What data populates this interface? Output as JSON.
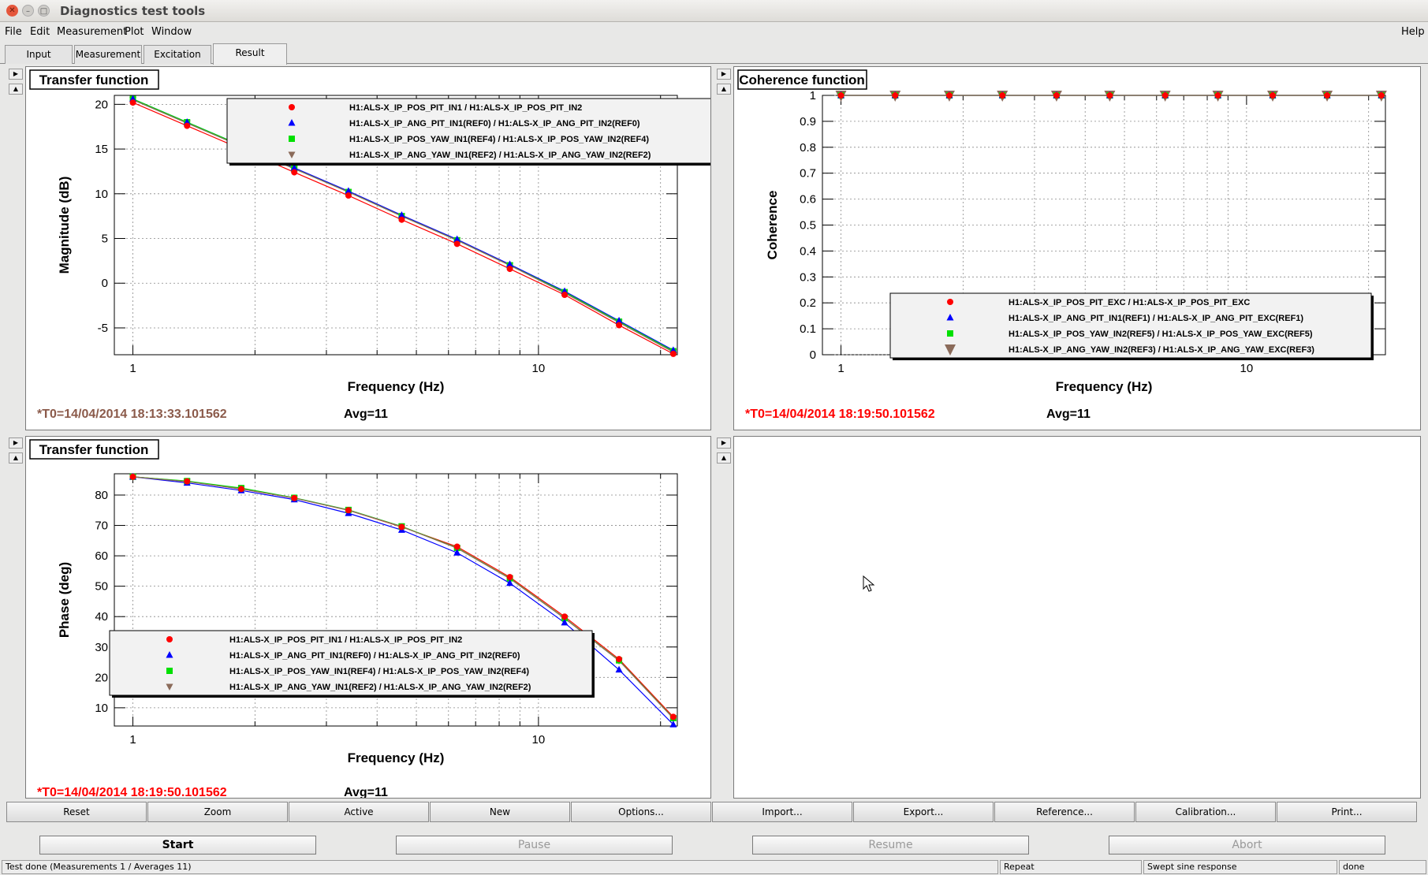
{
  "window": {
    "title": "Diagnostics test tools"
  },
  "menu": {
    "file": "File",
    "edit": "Edit",
    "measurement": "Measurement",
    "plot": "Plot",
    "window": "Window",
    "help": "Help"
  },
  "tabs": [
    {
      "label": "Input"
    },
    {
      "label": "Measurement"
    },
    {
      "label": "Excitation"
    },
    {
      "label": "Result",
      "active": true
    }
  ],
  "icons": {
    "close": "close-icon",
    "minimize": "minimize-icon",
    "maximize": "maximize-icon",
    "pad_next": "arrow-right-icon",
    "pad_prev": "arrow-up-icon",
    "cursor": "mouse-pointer-icon"
  },
  "colors": {
    "series": [
      "#ff0000",
      "#0000ff",
      "#00e000",
      "#8b6b5a"
    ],
    "timestamp_brown": "#8b5a4a",
    "timestamp_red": "#ff0000"
  },
  "pads": {
    "tl": {
      "title": "Transfer function",
      "t0": "*T0=14/04/2014 18:13:33.101562",
      "avg": "Avg=11"
    },
    "tr": {
      "title": "Coherence function",
      "t0": "*T0=14/04/2014 18:19:50.101562",
      "avg": "Avg=11"
    },
    "bl": {
      "title": "Transfer function",
      "t0": "*T0=14/04/2014 18:19:50.101562",
      "avg": "Avg=11"
    }
  },
  "chart_data": [
    {
      "type": "line",
      "title": "Transfer function",
      "xlabel": "Frequency (Hz)",
      "ylabel": "Magnitude (dB)",
      "xscale": "log",
      "xlim": [
        0.9,
        22
      ],
      "ylim": [
        -8,
        21
      ],
      "yticks": [
        -5,
        0,
        5,
        10,
        15,
        20
      ],
      "xticks": [
        1,
        10
      ],
      "legend_position": "top-right",
      "x": [
        1,
        1.36,
        1.85,
        2.5,
        3.4,
        4.6,
        6.3,
        8.5,
        11.6,
        15.8,
        21.5
      ],
      "series": [
        {
          "name": "H1:ALS-X_IP_POS_PIT_IN1 / H1:ALS-X_IP_POS_PIT_IN2",
          "marker": "circle",
          "values": [
            20.2,
            17.6,
            15.0,
            12.4,
            9.8,
            7.1,
            4.4,
            1.6,
            -1.3,
            -4.7,
            -7.9
          ]
        },
        {
          "name": "H1:ALS-X_IP_ANG_PIT_IN1(REF0) / H1:ALS-X_IP_ANG_PIT_IN2(REF0)",
          "marker": "triangle",
          "values": [
            20.6,
            18.0,
            15.4,
            12.9,
            10.3,
            7.6,
            4.9,
            2.1,
            -0.9,
            -4.2,
            -7.5
          ]
        },
        {
          "name": "H1:ALS-X_IP_POS_YAW_IN1(REF4) / H1:ALS-X_IP_POS_YAW_IN2(REF4)",
          "marker": "square",
          "values": [
            20.6,
            18.0,
            15.4,
            12.8,
            10.2,
            7.5,
            4.8,
            2.0,
            -1.0,
            -4.3,
            -7.6
          ]
        },
        {
          "name": "H1:ALS-X_IP_ANG_YAW_IN1(REF2) / H1:ALS-X_IP_ANG_YAW_IN2(REF2)",
          "marker": "triangle-down",
          "values": [
            20.5,
            17.9,
            15.3,
            12.8,
            10.2,
            7.5,
            4.8,
            2.0,
            -1.1,
            -4.4,
            -7.7
          ]
        }
      ]
    },
    {
      "type": "line",
      "title": "Coherence function",
      "xlabel": "Frequency (Hz)",
      "ylabel": "Coherence",
      "xscale": "log",
      "xlim": [
        0.9,
        22
      ],
      "ylim": [
        0,
        1
      ],
      "yticks": [
        0,
        0.1,
        0.2,
        0.3,
        0.4,
        0.5,
        0.6,
        0.7,
        0.8,
        0.9,
        1
      ],
      "xticks": [
        1,
        10
      ],
      "legend_position": "bottom-right",
      "x": [
        1,
        1.36,
        1.85,
        2.5,
        3.4,
        4.6,
        6.3,
        8.5,
        11.6,
        15.8,
        21.5
      ],
      "series": [
        {
          "name": "H1:ALS-X_IP_POS_PIT_EXC / H1:ALS-X_IP_POS_PIT_EXC",
          "marker": "circle",
          "values": [
            1,
            1,
            1,
            1,
            1,
            1,
            1,
            1,
            1,
            1,
            1
          ]
        },
        {
          "name": "H1:ALS-X_IP_ANG_PIT_IN1(REF1) / H1:ALS-X_IP_ANG_PIT_EXC(REF1)",
          "marker": "triangle",
          "values": [
            1,
            1,
            1,
            1,
            1,
            1,
            1,
            1,
            1,
            1,
            1
          ]
        },
        {
          "name": "H1:ALS-X_IP_POS_YAW_IN2(REF5) / H1:ALS-X_IP_POS_YAW_EXC(REF5)",
          "marker": "square",
          "values": [
            1,
            1,
            1,
            1,
            1,
            1,
            1,
            1,
            1,
            1,
            1
          ]
        },
        {
          "name": "H1:ALS-X_IP_ANG_YAW_IN2(REF3) / H1:ALS-X_IP_ANG_YAW_EXC(REF3)",
          "marker": "triangle-down-large",
          "values": [
            1,
            1,
            1,
            1,
            1,
            1,
            1,
            1,
            1,
            1,
            1
          ]
        }
      ]
    },
    {
      "type": "line",
      "title": "Transfer function",
      "xlabel": "Frequency (Hz)",
      "ylabel": "Phase (deg)",
      "xscale": "log",
      "xlim": [
        0.9,
        22
      ],
      "ylim": [
        4,
        87
      ],
      "yticks": [
        10,
        20,
        30,
        40,
        50,
        60,
        70,
        80
      ],
      "xticks": [
        1,
        10
      ],
      "legend_position": "bottom-left",
      "x": [
        1,
        1.36,
        1.85,
        2.5,
        3.4,
        4.6,
        6.3,
        8.5,
        11.6,
        15.8,
        21.5
      ],
      "series": [
        {
          "name": "H1:ALS-X_IP_POS_PIT_IN1 / H1:ALS-X_IP_POS_PIT_IN2",
          "marker": "circle",
          "values": [
            86,
            84.5,
            82,
            79,
            75,
            69.5,
            63,
            53,
            40,
            26,
            7
          ]
        },
        {
          "name": "H1:ALS-X_IP_ANG_PIT_IN1(REF0) / H1:ALS-X_IP_ANG_PIT_IN2(REF0)",
          "marker": "triangle",
          "values": [
            86,
            84,
            81.5,
            78.5,
            74,
            68.5,
            61,
            51,
            38,
            22.5,
            4.5
          ]
        },
        {
          "name": "H1:ALS-X_IP_POS_YAW_IN1(REF4) / H1:ALS-X_IP_POS_YAW_IN2(REF4)",
          "marker": "square",
          "values": [
            86,
            84.6,
            82.3,
            79.1,
            75.1,
            69.7,
            62.6,
            52.6,
            39.5,
            25.6,
            6.6
          ]
        },
        {
          "name": "H1:ALS-X_IP_ANG_YAW_IN1(REF2) / H1:ALS-X_IP_ANG_YAW_IN2(REF2)",
          "marker": "triangle-down",
          "values": [
            86,
            84.4,
            82,
            79,
            75,
            69.6,
            62.5,
            52.5,
            39.4,
            25.5,
            6.5
          ]
        }
      ]
    }
  ],
  "buttons": [
    "Reset",
    "Zoom",
    "Active",
    "New",
    "Options...",
    "Import...",
    "Export...",
    "Reference...",
    "Calibration...",
    "Print..."
  ],
  "controls": {
    "start": "Start",
    "pause": "Pause",
    "resume": "Resume",
    "abort": "Abort"
  },
  "status": {
    "message": "Test done (Measurements 1 / Averages 11)",
    "mode": "Repeat",
    "type": "Swept sine response",
    "state": "done"
  }
}
